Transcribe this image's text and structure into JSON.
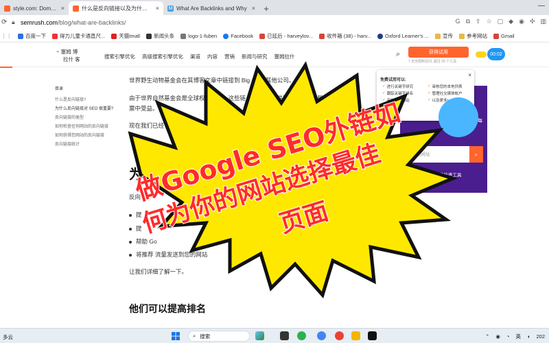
{
  "browser": {
    "tabs": [
      {
        "title": "style.com: Domain Over",
        "favicon": "semrush-icon"
      },
      {
        "title": "什么是反向链接以及为什么它们重要",
        "favicon": "semrush-icon",
        "active": true
      },
      {
        "title": "What Are Backlinks and Why",
        "favicon": "m-icon"
      }
    ],
    "new_tab": "+",
    "window_controls": "—",
    "url_host": "semrush.com",
    "url_path": "/blog/what-are-backlinks/",
    "bookmarks": [
      {
        "label": "百度一下",
        "icon": "baidu-icon"
      },
      {
        "label": "得力儿童卡通直尺...",
        "icon": "deli-icon"
      },
      {
        "label": "天猫tmall",
        "icon": "tmall-icon"
      },
      {
        "label": "新闻头条",
        "icon": "news-icon"
      },
      {
        "label": "logo-1-fuben",
        "icon": "logo-icon"
      },
      {
        "label": "Facebook",
        "icon": "facebook-icon"
      },
      {
        "label": "已延后 - harveylov...",
        "icon": "gmail-icon"
      },
      {
        "label": "收件箱 (38) - harv...",
        "icon": "gmail-icon"
      },
      {
        "label": "Oxford Learner's ...",
        "icon": "oxford-icon"
      },
      {
        "label": "宣传",
        "icon": "folder-icon"
      },
      {
        "label": "参考网站",
        "icon": "folder-icon"
      },
      {
        "label": "Gmail",
        "icon": "gmail-icon"
      }
    ]
  },
  "site": {
    "logo_line1": "塞姆 博",
    "logo_line2": "拉什 客",
    "nav": [
      "搜索引擎优化",
      "高级搜索引擎优化",
      "渠道",
      "内容",
      "营销",
      "新闻与研究",
      "塞姆拉什"
    ],
    "trial_button": "获得试用",
    "trial_sub": "7 天无限制访问, 超过 55 个工具",
    "timer": "00:02"
  },
  "toc": {
    "heading": "目录",
    "items": [
      "什么是反向链接?",
      "为什么反向链接对 SEO 很重要?",
      "反向链接的类型",
      "如何检查任何网站的反向链接",
      "如何获得您网站的反向链接",
      "反向链接统计"
    ]
  },
  "article": {
    "p1": "世界野生动物基金会在其博客文章中链接到 Big     en 和其他公司。",
    "p2": "由于世界自然基金会是全球权威机构，这些链           搜索引擎提供了一个值得信赖的搜索信任票中受益。",
    "p3": "现在我们已经了解了反向链接的定          于 SEO 如此重要。",
    "h2": "为什么",
    "p4": "反向",
    "bullets": [
      "提",
      "提",
      "帮助 Go",
      "将推荐     流量发送到您的网站"
    ],
    "p5": "让我们详细了解一下。",
    "h2b": "他们可以提高排名"
  },
  "widget": {
    "line": "每",
    "input_placeholder": "入您的网址",
    "note": "免费关键字排名检查工具"
  },
  "popup": {
    "title": "免费试用可以:",
    "left_items": [
      "进行关键字研究",
      "跟踪关键字排名",
      "审核您的网站"
    ],
    "right_items": [
      "审核您的本地列表",
      "管理社交媒体帐户",
      "以及更多!"
    ],
    "close": "×"
  },
  "overlay": {
    "line1": "做Google SEO外链如",
    "line2": "何为你的网站选择最佳",
    "line3": "页面",
    "colors": {
      "burst_fill": "#ffe800",
      "burst_stroke": "#111111",
      "text": "#ff2b2b",
      "text_outline": "#ffffff"
    }
  },
  "taskbar": {
    "weather": "多云",
    "search": "搜索",
    "ime": "英",
    "clock": "202"
  },
  "colors": {
    "accent": "#ff642d",
    "widget_bg": "#4a1e8e"
  }
}
